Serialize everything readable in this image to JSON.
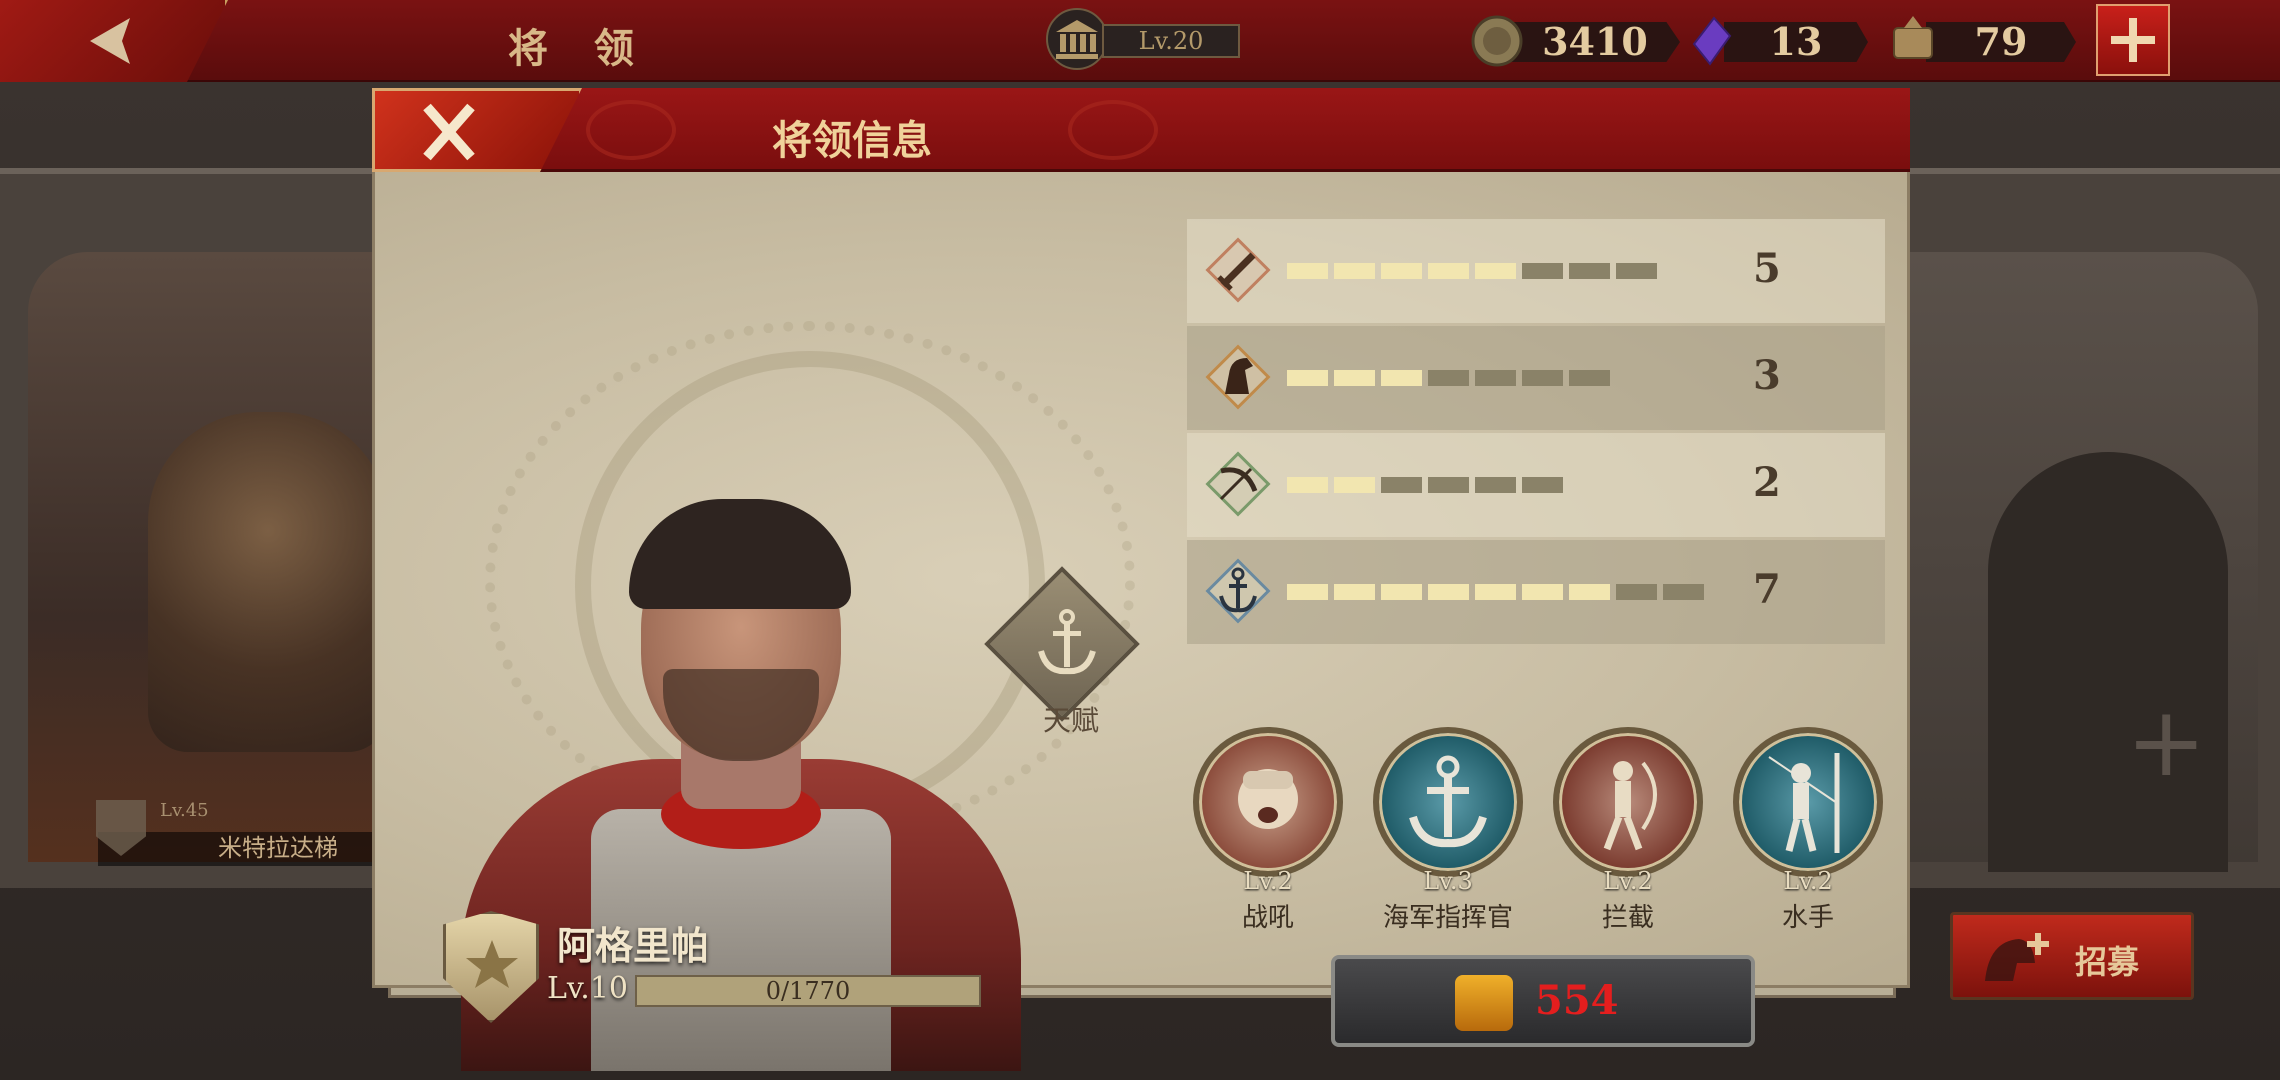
{
  "topbar": {
    "title": "将 领",
    "city_level": "Lv.20",
    "coins": "3410",
    "gems": "13",
    "tokens": "79"
  },
  "background": {
    "left_general_level": "Lv.45",
    "left_general_name": "米特拉达梯",
    "recruit_label": "招募"
  },
  "modal": {
    "title": "将领信息",
    "talent_label": "天赋",
    "hero": {
      "name": "阿格里帕",
      "level": "Lv.10",
      "exp": "0/1770"
    },
    "stats": [
      {
        "icon": "sword-icon",
        "value": "5",
        "filled": 5,
        "total": 8,
        "color": "#c08060"
      },
      {
        "icon": "horse-icon",
        "value": "3",
        "filled": 3,
        "total": 7,
        "color": "#c08a4a"
      },
      {
        "icon": "bow-icon",
        "value": "2",
        "filled": 2,
        "total": 6,
        "color": "#7a9a6a"
      },
      {
        "icon": "anchor-icon",
        "value": "7",
        "filled": 7,
        "total": 9,
        "color": "#6a8aa0"
      }
    ],
    "skills": [
      {
        "level": "Lv.2",
        "name": "战吼",
        "theme": "red"
      },
      {
        "level": "Lv.3",
        "name": "海军指挥官",
        "theme": "teal"
      },
      {
        "level": "Lv.2",
        "name": "拦截",
        "theme": "red"
      },
      {
        "level": "Lv.2",
        "name": "水手",
        "theme": "teal"
      }
    ],
    "cost": "554"
  }
}
